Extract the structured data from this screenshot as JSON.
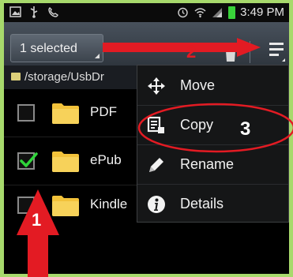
{
  "status_bar": {
    "time": "3:49 PM",
    "left_icons": [
      "image-icon",
      "usb-icon",
      "phone-icon"
    ],
    "right_icons": [
      "alarm-icon",
      "wifi-icon",
      "signal-icon",
      "battery-icon"
    ]
  },
  "action_bar": {
    "selection_label": "1 selected",
    "delete_icon": "trash-icon",
    "overflow_icon": "overflow-menu-icon"
  },
  "path_bar": {
    "path": "/storage/UsbDr"
  },
  "files": [
    {
      "name": "PDF",
      "checked": false
    },
    {
      "name": "ePub",
      "checked": true
    },
    {
      "name": "Kindle",
      "checked": false
    }
  ],
  "menu": {
    "items": [
      {
        "label": "Move",
        "icon": "move-icon"
      },
      {
        "label": "Copy",
        "icon": "copy-icon"
      },
      {
        "label": "Rename",
        "icon": "rename-icon"
      },
      {
        "label": "Details",
        "icon": "info-icon"
      }
    ]
  },
  "annotations": {
    "step1": "1",
    "step2": "2",
    "step3": "3",
    "color": "#e31b23"
  },
  "colors": {
    "check": "#2fd43a",
    "folder": "#f2c23a",
    "accent_battery": "#39d33a"
  }
}
